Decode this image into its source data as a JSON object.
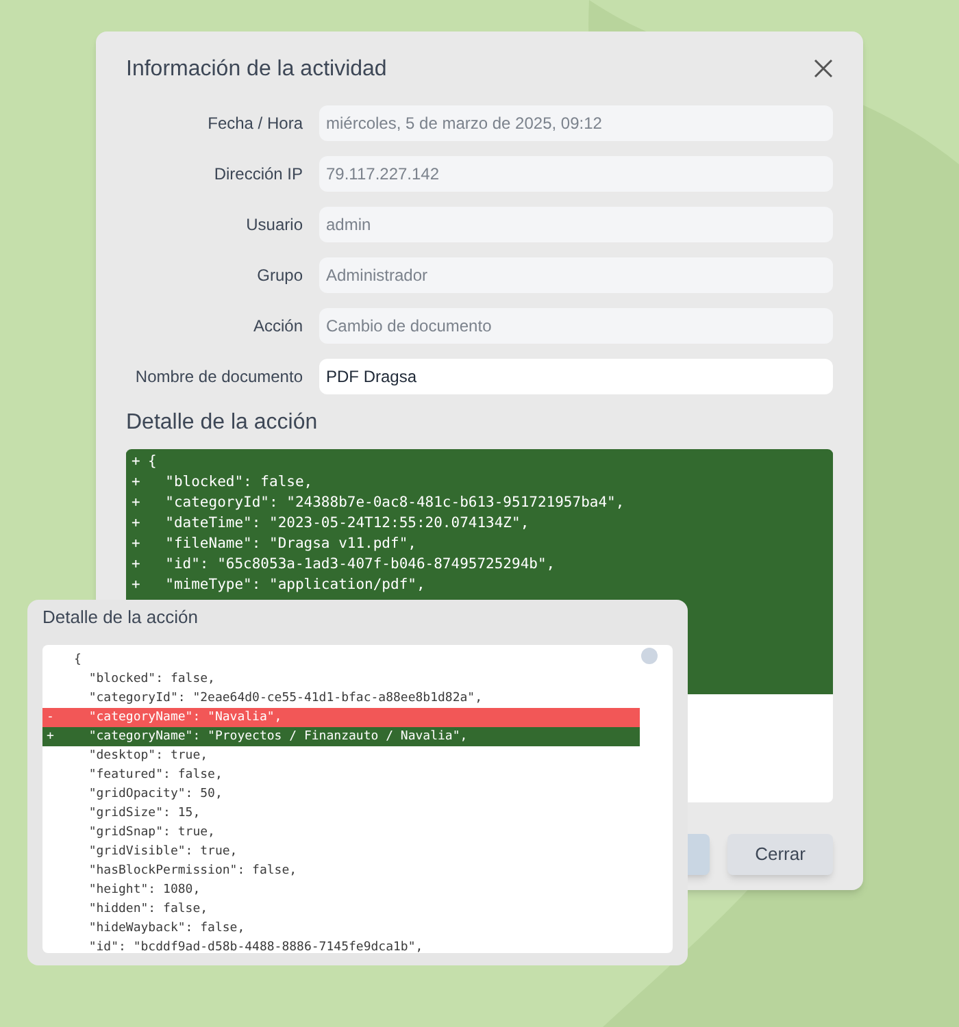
{
  "dialog": {
    "title": "Información de la actividad",
    "fields": [
      {
        "label": "Fecha / Hora",
        "value": "miércoles, 5 de marzo de 2025, 09:12",
        "disabled": true
      },
      {
        "label": "Dirección IP",
        "value": "79.117.227.142",
        "disabled": true
      },
      {
        "label": "Usuario",
        "value": "admin",
        "disabled": true
      },
      {
        "label": "Grupo",
        "value": "Administrador",
        "disabled": true
      },
      {
        "label": "Acción",
        "value": "Cambio de documento",
        "disabled": true
      },
      {
        "label": "Nombre de documento",
        "value": "PDF Dragsa",
        "disabled": false
      }
    ],
    "detail_heading": "Detalle de la acción",
    "detail_lines": [
      {
        "kind": "added",
        "marker": "+",
        "text": "{"
      },
      {
        "kind": "added",
        "marker": "+",
        "text": "  \"blocked\": false,"
      },
      {
        "kind": "added",
        "marker": "+",
        "text": "  \"categoryId\": \"24388b7e-0ac8-481c-b613-951721957ba4\","
      },
      {
        "kind": "added",
        "marker": "+",
        "text": "  \"dateTime\": \"2023-05-24T12:55:20.074134Z\","
      },
      {
        "kind": "added",
        "marker": "+",
        "text": "  \"fileName\": \"Dragsa v11.pdf\","
      },
      {
        "kind": "added",
        "marker": "+",
        "text": "  \"id\": \"65c8053a-1ad3-407f-b046-87495725294b\","
      },
      {
        "kind": "added",
        "marker": "+",
        "text": "  \"mimeType\": \"application/pdf\","
      }
    ],
    "buttons": [
      {
        "kind": "primary"
      },
      {
        "kind": "secondary",
        "label": "Cerrar"
      }
    ]
  },
  "overlay_panel": {
    "title": "Detalle de la acción",
    "lines": [
      {
        "kind": "context",
        "text": "{"
      },
      {
        "kind": "context",
        "text": "  \"blocked\": false,"
      },
      {
        "kind": "context",
        "text": "  \"categoryId\": \"2eae64d0-ce55-41d1-bfac-a88ee8b1d82a\","
      },
      {
        "kind": "removed",
        "marker": "-",
        "text": "  \"categoryName\": \"Navalia\","
      },
      {
        "kind": "added",
        "marker": "+",
        "text": "  \"categoryName\": \"Proyectos / Finanzauto / Navalia\","
      },
      {
        "kind": "context",
        "text": "  \"desktop\": true,"
      },
      {
        "kind": "context",
        "text": "  \"featured\": false,"
      },
      {
        "kind": "context",
        "text": "  \"gridOpacity\": 50,"
      },
      {
        "kind": "context",
        "text": "  \"gridSize\": 15,"
      },
      {
        "kind": "context",
        "text": "  \"gridSnap\": true,"
      },
      {
        "kind": "context",
        "text": "  \"gridVisible\": true,"
      },
      {
        "kind": "context",
        "text": "  \"hasBlockPermission\": false,"
      },
      {
        "kind": "context",
        "text": "  \"height\": 1080,"
      },
      {
        "kind": "context",
        "text": "  \"hidden\": false,"
      },
      {
        "kind": "context",
        "text": "  \"hideWayback\": false,"
      },
      {
        "kind": "context",
        "text": "  \"id\": \"bcddf9ad-d58b-4488-8886-7145fe9dca1b\","
      }
    ]
  }
}
